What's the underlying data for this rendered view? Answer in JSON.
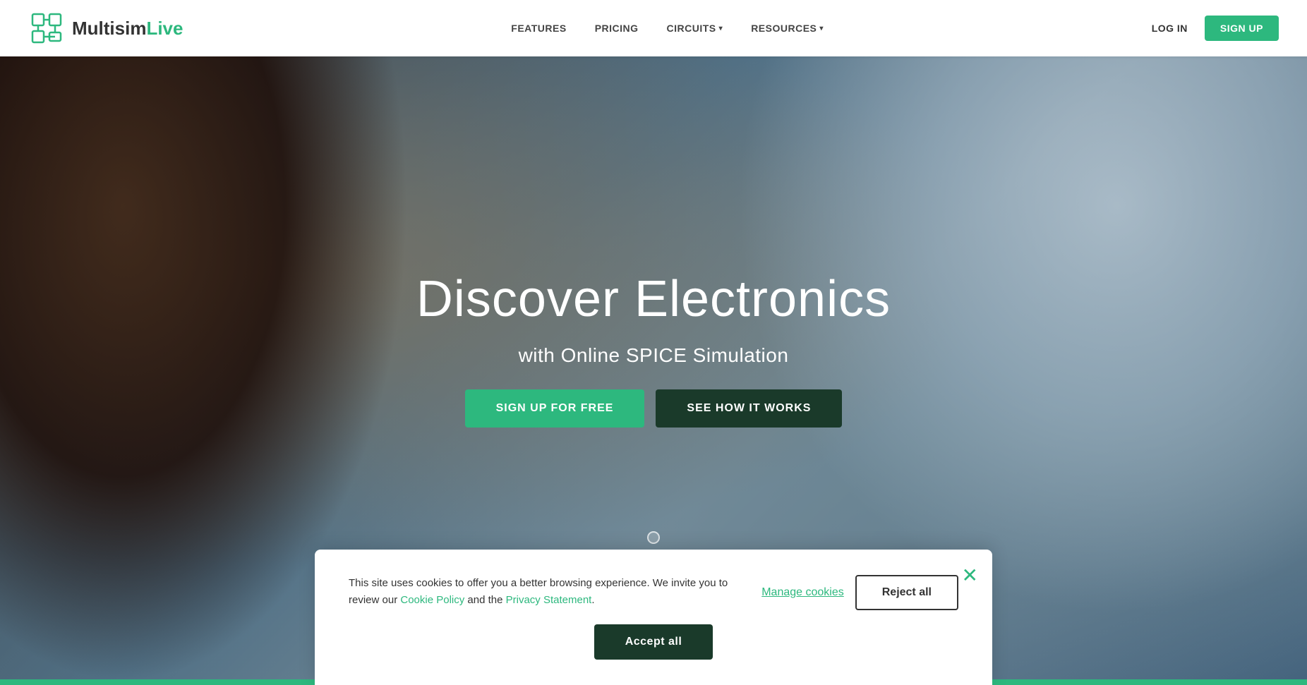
{
  "brand": {
    "name_start": "Multisim",
    "name_end": "Live",
    "logo_alt": "MultisimLive logo"
  },
  "navbar": {
    "links": [
      {
        "label": "FEATURES",
        "has_arrow": false
      },
      {
        "label": "PRICING",
        "has_arrow": false
      },
      {
        "label": "CIRCUITS",
        "has_arrow": true
      },
      {
        "label": "RESOURCES",
        "has_arrow": true
      }
    ],
    "login_label": "LOG IN",
    "signup_label": "SIGN UP"
  },
  "hero": {
    "title": "Discover Electronics",
    "subtitle": "with Online SPICE Simulation",
    "btn_signup": "SIGN UP FOR FREE",
    "btn_how": "SEE HOW IT WORKS"
  },
  "cookie": {
    "message_start": "This site uses cookies to offer you a better browsing experience. We invite you to review our ",
    "cookie_policy_label": "Cookie Policy",
    "message_mid": " and the ",
    "privacy_label": "Privacy Statement",
    "message_end": ".",
    "manage_label": "Manage cookies",
    "reject_label": "Reject all",
    "accept_label": "Accept all",
    "close_icon": "✕"
  }
}
